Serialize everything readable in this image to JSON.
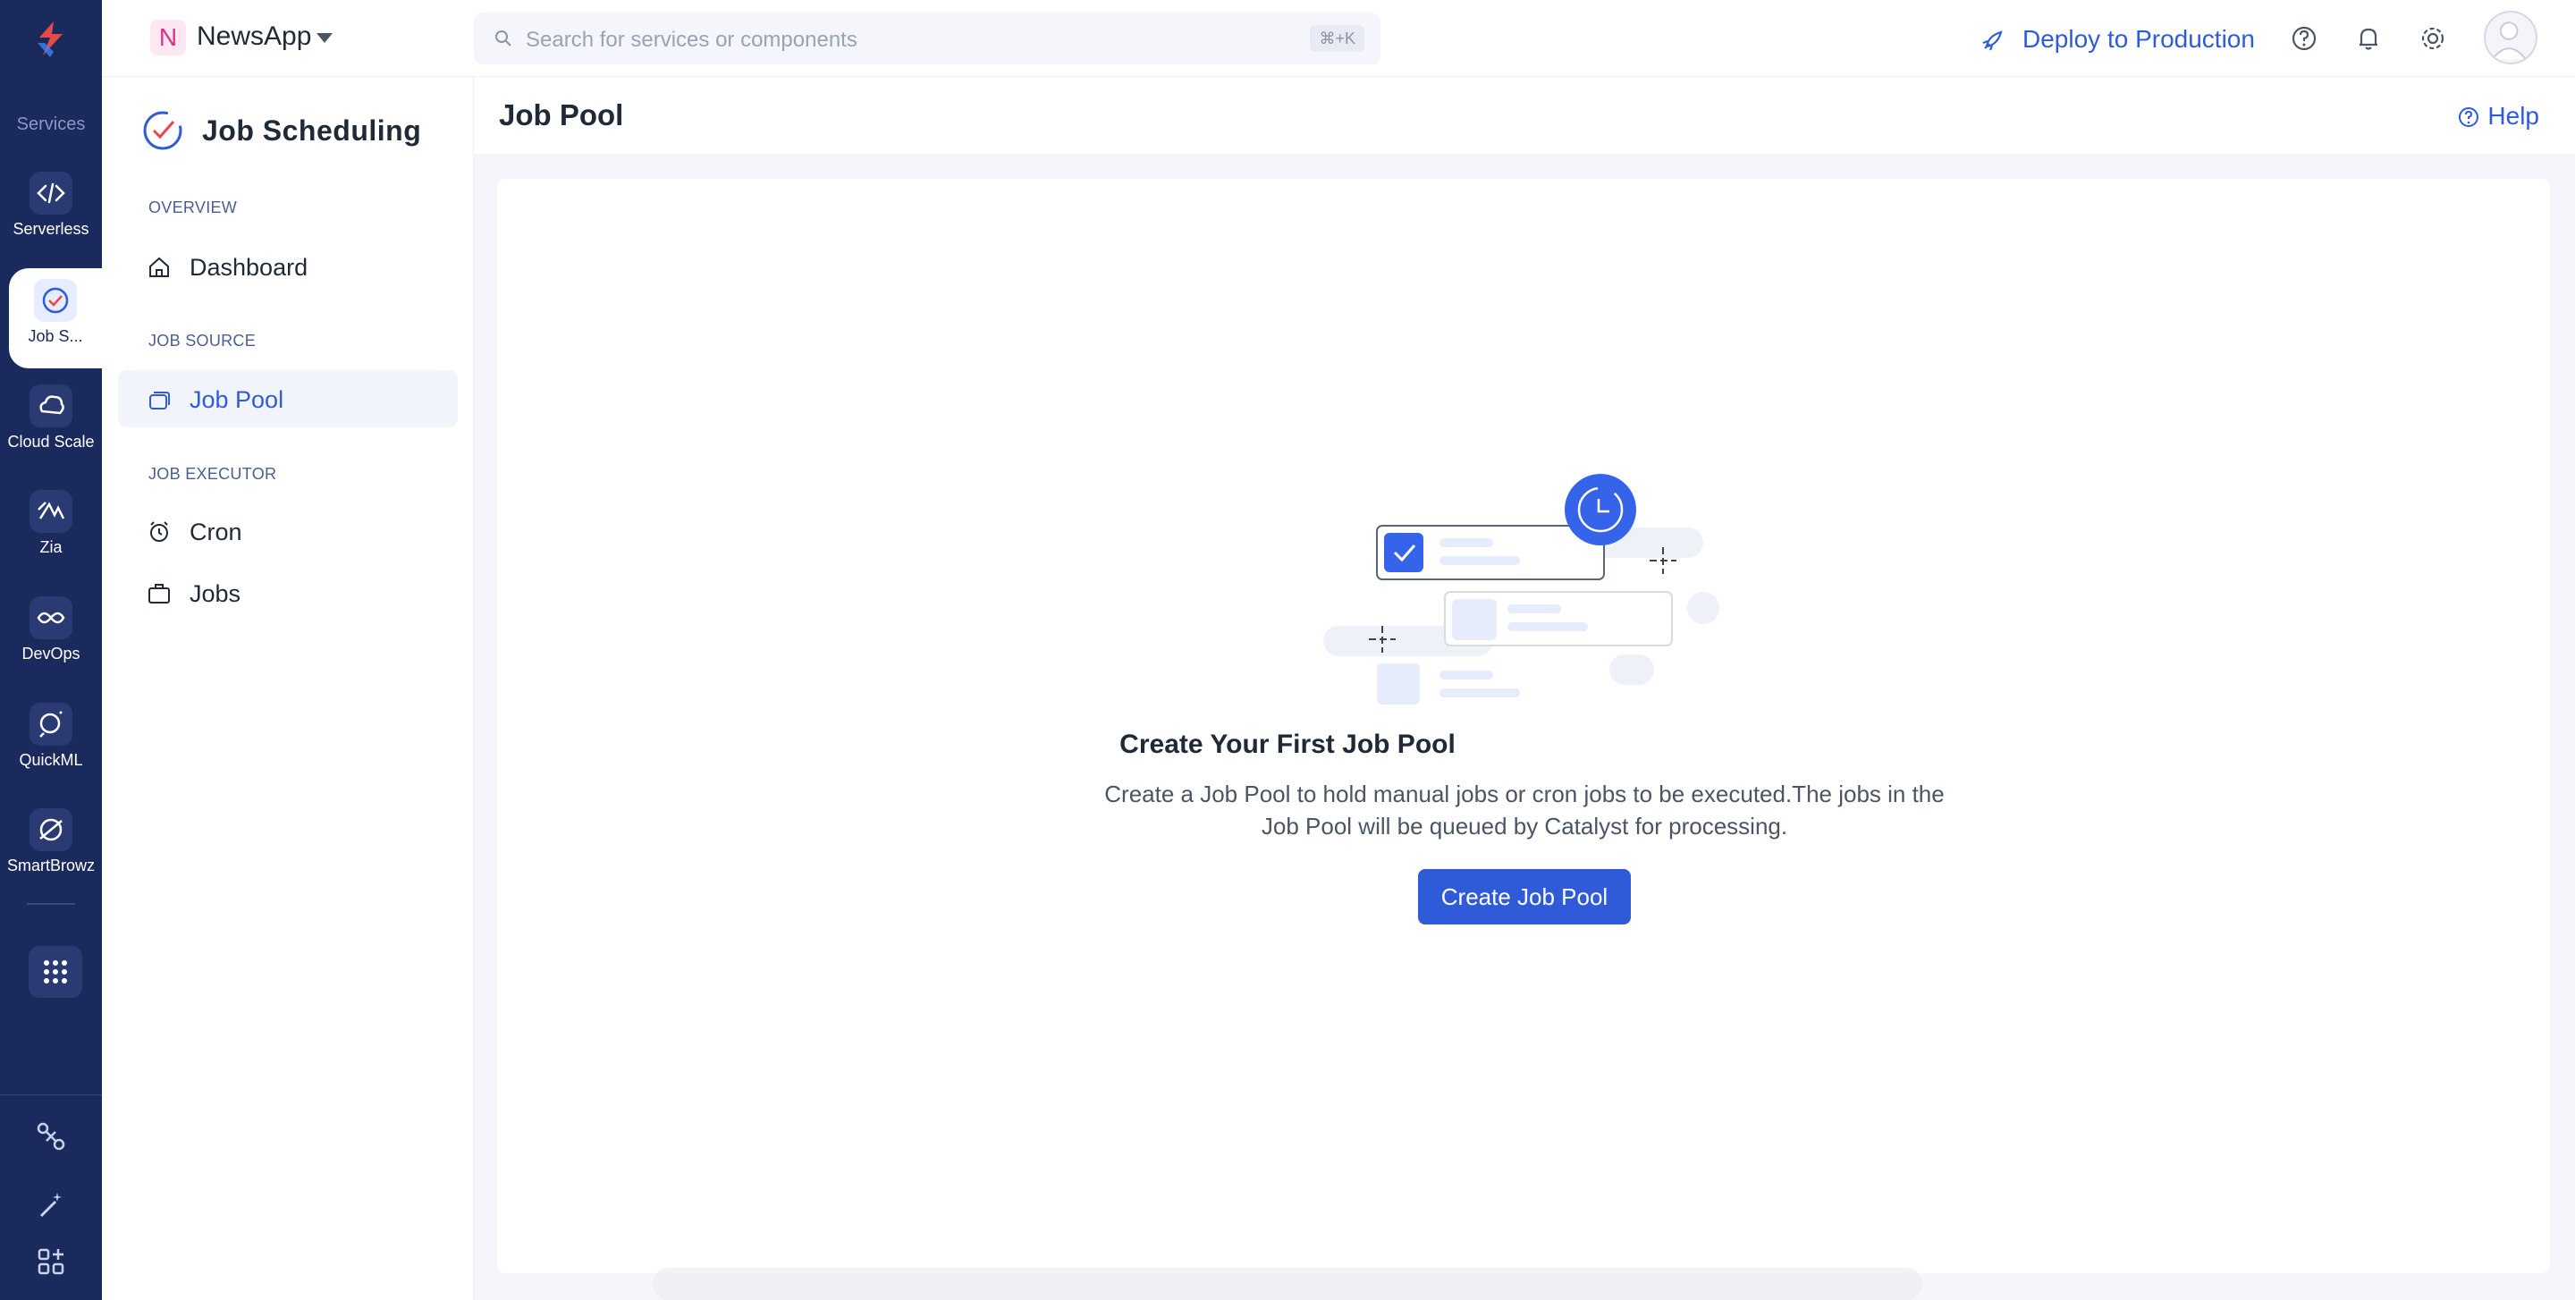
{
  "rail": {
    "section_label": "Services",
    "items": [
      {
        "label": "Serverless",
        "icon": "serverless-icon"
      },
      {
        "label": "Job S...",
        "icon": "job-scheduling-icon",
        "active": true
      },
      {
        "label": "Cloud Scale",
        "icon": "cloud-scale-icon"
      },
      {
        "label": "Zia",
        "icon": "zia-icon"
      },
      {
        "label": "DevOps",
        "icon": "devops-icon"
      },
      {
        "label": "QuickML",
        "icon": "quickml-icon"
      },
      {
        "label": "SmartBrowz",
        "icon": "smartbrowz-icon"
      }
    ]
  },
  "header": {
    "project_initial": "N",
    "project_name": "NewsApp",
    "search_placeholder": "Search for services or components",
    "search_shortcut": "⌘+K",
    "deploy_label": "Deploy to Production"
  },
  "sidebar": {
    "title": "Job Scheduling",
    "sections": [
      {
        "label": "OVERVIEW"
      },
      {
        "label": "JOB SOURCE"
      },
      {
        "label": "JOB EXECUTOR"
      }
    ],
    "items": [
      {
        "label": "Dashboard"
      },
      {
        "label": "Job Pool"
      },
      {
        "label": "Cron"
      },
      {
        "label": "Jobs"
      }
    ]
  },
  "main": {
    "title": "Job Pool",
    "help_label": "Help",
    "empty_title": "Create Your First Job Pool",
    "empty_desc_line1": "Create a Job Pool to hold manual jobs or cron jobs to be executed.The jobs in the",
    "empty_desc_line2": "Job Pool will be queued by Catalyst for processing.",
    "cta_label": "Create Job Pool"
  },
  "colors": {
    "rail_bg": "#1b2a5c",
    "accent": "#2f5bd8",
    "main_bg": "#f4f6fb"
  }
}
